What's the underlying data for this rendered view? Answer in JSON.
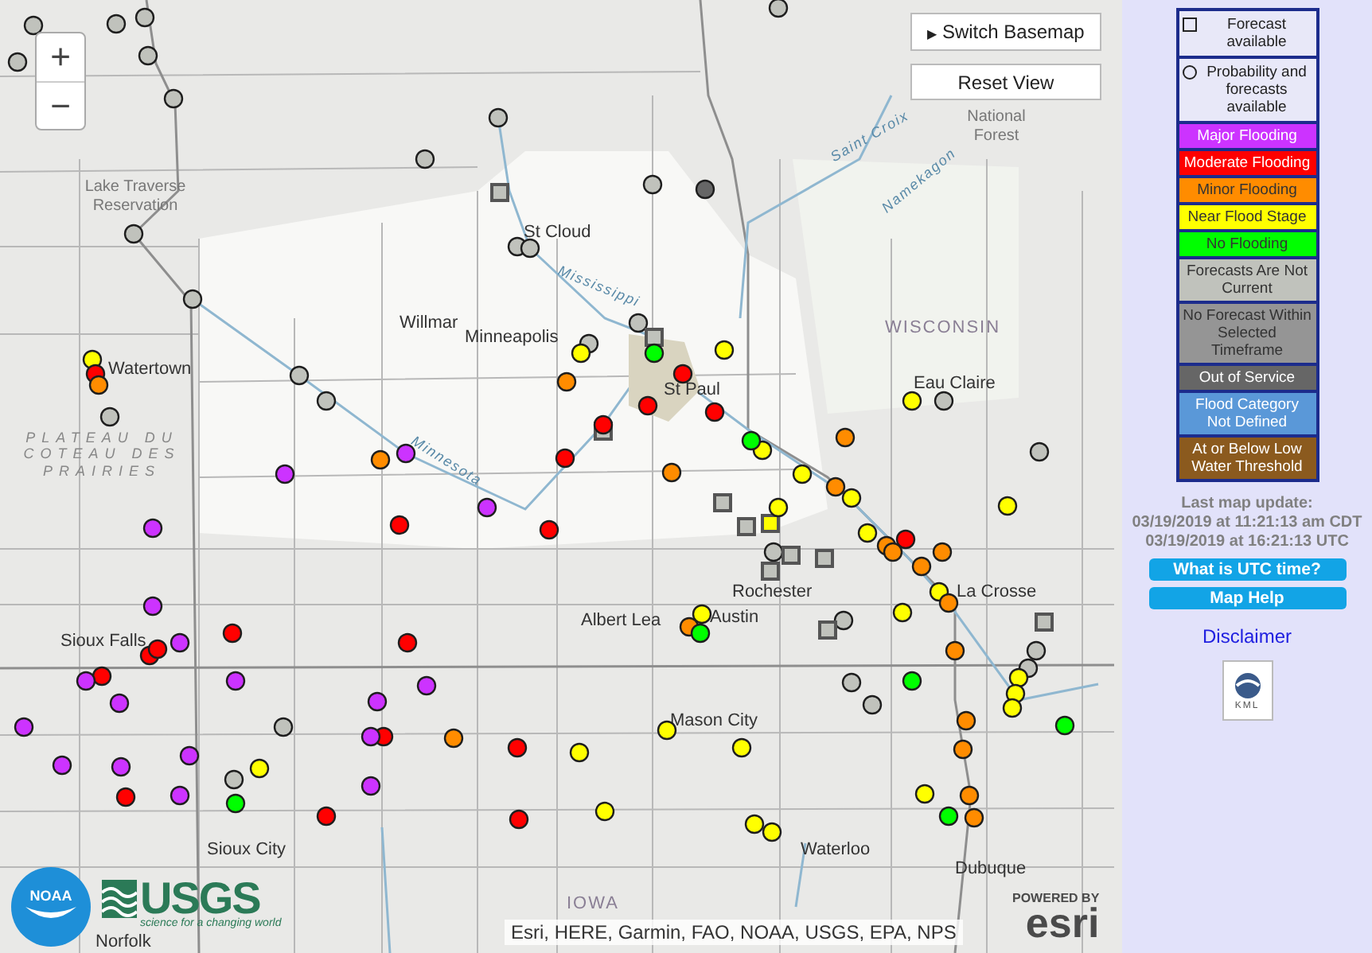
{
  "map": {
    "zoom_controls": [
      {
        "label": "+"
      },
      {
        "label": "−"
      }
    ],
    "switch_basemap": {
      "icon": "▶",
      "label": "Switch Basemap"
    },
    "reset_view": "Reset View",
    "place_labels": [
      {
        "text": "Lake Traverse Reservation",
        "kind": "area"
      },
      {
        "text": "Watertown",
        "kind": "city"
      },
      {
        "text": "PLATEAU DU COTEAU DES PRAIRIES",
        "kind": "region"
      },
      {
        "text": "St Cloud",
        "kind": "city"
      },
      {
        "text": "Willmar",
        "kind": "city"
      },
      {
        "text": "Mississippi",
        "kind": "river"
      },
      {
        "text": "Minneapolis",
        "kind": "city"
      },
      {
        "text": "St Paul",
        "kind": "city"
      },
      {
        "text": "Minnesota",
        "kind": "river"
      },
      {
        "text": "Saint Croix",
        "kind": "river"
      },
      {
        "text": "National Forest",
        "kind": "area"
      },
      {
        "text": "Namekagon",
        "kind": "river"
      },
      {
        "text": "WISCONSIN",
        "kind": "state"
      },
      {
        "text": "Eau Claire",
        "kind": "city"
      },
      {
        "text": "Rochester",
        "kind": "city"
      },
      {
        "text": "La Crosse",
        "kind": "city"
      },
      {
        "text": "Albert Lea",
        "kind": "city"
      },
      {
        "text": "Austin",
        "kind": "city"
      },
      {
        "text": "Sioux Falls",
        "kind": "city"
      },
      {
        "text": "Mason City",
        "kind": "city"
      },
      {
        "text": "Sioux City",
        "kind": "city"
      },
      {
        "text": "Waterloo",
        "kind": "city"
      },
      {
        "text": "Dubuque",
        "kind": "city"
      },
      {
        "text": "IOWA",
        "kind": "state"
      },
      {
        "text": "Norfolk",
        "kind": "city"
      }
    ],
    "gauges": [
      {
        "kind": "circle",
        "color": "#c0c2bc"
      },
      {
        "kind": "circle",
        "color": "#c0c2bc"
      },
      {
        "kind": "circle",
        "color": "#c0c2bc"
      },
      {
        "kind": "circle",
        "color": "#c0c2bc"
      },
      {
        "kind": "circle",
        "color": "#c0c2bc"
      },
      {
        "kind": "circle",
        "color": "#c0c2bc"
      },
      {
        "kind": "circle",
        "color": "#c0c2bc"
      },
      {
        "kind": "circle",
        "color": "#c0c2bc"
      },
      {
        "kind": "circle",
        "color": "#c0c2bc"
      },
      {
        "kind": "circle",
        "color": "#c0c2bc"
      },
      {
        "kind": "circle",
        "color": "#c0c2bc"
      },
      {
        "kind": "circle",
        "color": "#c0c2bc"
      },
      {
        "kind": "circle",
        "color": "#c0c2bc"
      },
      {
        "kind": "circle",
        "color": "#c0c2bc"
      },
      {
        "kind": "circle",
        "color": "#c0c2bc"
      },
      {
        "kind": "circle",
        "color": "#c0c2bc"
      },
      {
        "kind": "circle",
        "color": "#c0c2bc"
      },
      {
        "kind": "circle",
        "color": "#c0c2bc"
      },
      {
        "kind": "circle",
        "color": "#c0c2bc"
      },
      {
        "kind": "circle",
        "color": "#c0c2bc"
      },
      {
        "kind": "circle",
        "color": "#c0c2bc"
      },
      {
        "kind": "circle",
        "color": "#c0c2bc"
      },
      {
        "kind": "circle",
        "color": "#c0c2bc"
      },
      {
        "kind": "circle",
        "color": "#c0c2bc"
      },
      {
        "kind": "circle",
        "color": "#c0c2bc"
      },
      {
        "kind": "circle",
        "color": "#c0c2bc"
      },
      {
        "kind": "circle",
        "color": "#c0c2bc"
      },
      {
        "kind": "circle",
        "color": "#c0c2bc"
      },
      {
        "kind": "circle",
        "color": "#c0c2bc"
      },
      {
        "kind": "circle",
        "color": "#666666"
      },
      {
        "kind": "square",
        "color": "#c0c2bc"
      },
      {
        "kind": "square",
        "color": "#c0c2bc"
      },
      {
        "kind": "square",
        "color": "#c0c2bc"
      },
      {
        "kind": "square",
        "color": "#c0c2bc"
      },
      {
        "kind": "square",
        "color": "#c0c2bc"
      },
      {
        "kind": "square",
        "color": "#c0c2bc"
      },
      {
        "kind": "square",
        "color": "#c0c2bc"
      },
      {
        "kind": "square",
        "color": "#c0c2bc"
      },
      {
        "kind": "square",
        "color": "#c0c2bc"
      },
      {
        "kind": "square",
        "color": "#c0c2bc"
      },
      {
        "kind": "square",
        "color": "#ffff00"
      },
      {
        "kind": "circle",
        "color": "#ffff00"
      },
      {
        "kind": "circle",
        "color": "#ffff00"
      },
      {
        "kind": "circle",
        "color": "#ffff00"
      },
      {
        "kind": "circle",
        "color": "#ffff00"
      },
      {
        "kind": "circle",
        "color": "#ffff00"
      },
      {
        "kind": "circle",
        "color": "#ffff00"
      },
      {
        "kind": "circle",
        "color": "#ffff00"
      },
      {
        "kind": "circle",
        "color": "#ffff00"
      },
      {
        "kind": "circle",
        "color": "#ffff00"
      },
      {
        "kind": "circle",
        "color": "#ffff00"
      },
      {
        "kind": "circle",
        "color": "#ffff00"
      },
      {
        "kind": "circle",
        "color": "#ffff00"
      },
      {
        "kind": "circle",
        "color": "#ffff00"
      },
      {
        "kind": "circle",
        "color": "#ffff00"
      },
      {
        "kind": "circle",
        "color": "#ffff00"
      },
      {
        "kind": "circle",
        "color": "#ffff00"
      },
      {
        "kind": "circle",
        "color": "#ffff00"
      },
      {
        "kind": "circle",
        "color": "#ffff00"
      },
      {
        "kind": "circle",
        "color": "#ffff00"
      },
      {
        "kind": "circle",
        "color": "#ffff00"
      },
      {
        "kind": "circle",
        "color": "#ffff00"
      },
      {
        "kind": "circle",
        "color": "#ffff00"
      },
      {
        "kind": "circle",
        "color": "#ffff00"
      },
      {
        "kind": "circle",
        "color": "#ffff00"
      },
      {
        "kind": "circle",
        "color": "#ff0000"
      },
      {
        "kind": "circle",
        "color": "#ff0000"
      },
      {
        "kind": "circle",
        "color": "#ff0000"
      },
      {
        "kind": "circle",
        "color": "#ff0000"
      },
      {
        "kind": "circle",
        "color": "#ff0000"
      },
      {
        "kind": "circle",
        "color": "#ff0000"
      },
      {
        "kind": "circle",
        "color": "#ff0000"
      },
      {
        "kind": "circle",
        "color": "#ff0000"
      },
      {
        "kind": "circle",
        "color": "#ff0000"
      },
      {
        "kind": "circle",
        "color": "#ff0000"
      },
      {
        "kind": "circle",
        "color": "#ff0000"
      },
      {
        "kind": "circle",
        "color": "#ff0000"
      },
      {
        "kind": "circle",
        "color": "#ff0000"
      },
      {
        "kind": "circle",
        "color": "#ff0000"
      },
      {
        "kind": "circle",
        "color": "#ff0000"
      },
      {
        "kind": "circle",
        "color": "#ff0000"
      },
      {
        "kind": "circle",
        "color": "#ff0000"
      },
      {
        "kind": "circle",
        "color": "#ff0000"
      },
      {
        "kind": "circle",
        "color": "#ff0000"
      },
      {
        "kind": "circle",
        "color": "#ff8c00"
      },
      {
        "kind": "circle",
        "color": "#ff8c00"
      },
      {
        "kind": "circle",
        "color": "#ff8c00"
      },
      {
        "kind": "circle",
        "color": "#ff8c00"
      },
      {
        "kind": "circle",
        "color": "#ff8c00"
      },
      {
        "kind": "circle",
        "color": "#ff8c00"
      },
      {
        "kind": "circle",
        "color": "#ff8c00"
      },
      {
        "kind": "circle",
        "color": "#ff8c00"
      },
      {
        "kind": "circle",
        "color": "#ff8c00"
      },
      {
        "kind": "circle",
        "color": "#ff8c00"
      },
      {
        "kind": "circle",
        "color": "#ff8c00"
      },
      {
        "kind": "circle",
        "color": "#ff8c00"
      },
      {
        "kind": "circle",
        "color": "#ff8c00"
      },
      {
        "kind": "circle",
        "color": "#ff8c00"
      },
      {
        "kind": "circle",
        "color": "#ff8c00"
      },
      {
        "kind": "circle",
        "color": "#ff8c00"
      },
      {
        "kind": "circle",
        "color": "#ff8c00"
      },
      {
        "kind": "circle",
        "color": "#ff8c00"
      },
      {
        "kind": "circle",
        "color": "#00ff00"
      },
      {
        "kind": "circle",
        "color": "#00ff00"
      },
      {
        "kind": "circle",
        "color": "#00ff00"
      },
      {
        "kind": "circle",
        "color": "#00ff00"
      },
      {
        "kind": "circle",
        "color": "#00ff00"
      },
      {
        "kind": "circle",
        "color": "#00ff00"
      },
      {
        "kind": "circle",
        "color": "#00ff00"
      },
      {
        "kind": "circle",
        "color": "#cc33ff"
      },
      {
        "kind": "circle",
        "color": "#cc33ff"
      },
      {
        "kind": "circle",
        "color": "#cc33ff"
      },
      {
        "kind": "circle",
        "color": "#cc33ff"
      },
      {
        "kind": "circle",
        "color": "#cc33ff"
      },
      {
        "kind": "circle",
        "color": "#cc33ff"
      },
      {
        "kind": "circle",
        "color": "#cc33ff"
      },
      {
        "kind": "circle",
        "color": "#cc33ff"
      },
      {
        "kind": "circle",
        "color": "#cc33ff"
      },
      {
        "kind": "circle",
        "color": "#cc33ff"
      },
      {
        "kind": "circle",
        "color": "#cc33ff"
      },
      {
        "kind": "circle",
        "color": "#cc33ff"
      },
      {
        "kind": "circle",
        "color": "#cc33ff"
      },
      {
        "kind": "circle",
        "color": "#cc33ff"
      },
      {
        "kind": "circle",
        "color": "#cc33ff"
      },
      {
        "kind": "circle",
        "color": "#cc33ff"
      },
      {
        "kind": "circle",
        "color": "#cc33ff"
      },
      {
        "kind": "circle",
        "color": "#cc33ff"
      }
    ],
    "attribution": "Esri, HERE, Garmin, FAO, NOAA, USGS, EPA, NPS",
    "noaa_logo": "NOAA",
    "usgs_logo": {
      "name": "USGS",
      "tagline": "science for a changing world"
    },
    "esri_logo": {
      "powered": "POWERED BY",
      "name": "esri"
    }
  },
  "legend": {
    "symbols": [
      {
        "kind": "square",
        "label": "Forecast available"
      },
      {
        "kind": "circle",
        "label": "Probability and forecasts available"
      }
    ],
    "categories": [
      {
        "label": "Major Flooding",
        "color": "#cc33ff"
      },
      {
        "label": "Moderate Flooding",
        "color": "#ff0000"
      },
      {
        "label": "Minor Flooding",
        "color": "#ff8c00"
      },
      {
        "label": "Near Flood Stage",
        "color": "#ffff00"
      },
      {
        "label": "No Flooding",
        "color": "#00ff00"
      },
      {
        "label": "Forecasts Are Not Current",
        "color": "#c0c2bc"
      },
      {
        "label": "No Forecast Within Selected Timeframe",
        "color": "#959595"
      },
      {
        "label": "Out of Service",
        "color": "#666666"
      },
      {
        "label": "Flood Category Not Defined",
        "color": "#5a98d8"
      },
      {
        "label": "At or Below Low Water Threshold",
        "color": "#8b5a1e"
      }
    ]
  },
  "update": {
    "heading": "Last map update:",
    "local": "03/19/2019 at 11:21:13 am CDT",
    "utc": "03/19/2019 at 16:21:13 UTC"
  },
  "buttons": [
    "What is UTC time?",
    "Map Help"
  ],
  "disclaimer": "Disclaimer",
  "kml": "KML"
}
